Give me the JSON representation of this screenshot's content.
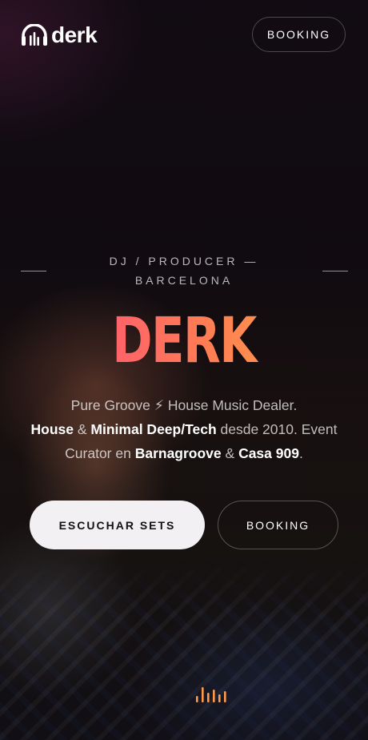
{
  "header": {
    "logo_text": "derk",
    "booking_label": "BOOKING"
  },
  "hero": {
    "tagline": "DJ / PRODUCER — BARCELONA",
    "title": "DERK",
    "description": {
      "part1": "Pure Groove ⚡ House Music Dealer.",
      "strong1": "House",
      "amp1": " & ",
      "strong2": "Minimal Deep/Tech",
      "part2": " desde 2010. Event Curator en ",
      "strong3": "Barnagroove",
      "amp2": " & ",
      "strong4": "Casa 909",
      "end": "."
    },
    "primary_button": "ESCUCHAR SETS",
    "secondary_button": "BOOKING"
  },
  "icons": {
    "logo": "headphones-equalizer-icon",
    "scroll": "equalizer-icon"
  },
  "colors": {
    "title_gradient_start": "#ff4e7a",
    "title_gradient_end": "#ffa646",
    "primary_button_bg": "#f2f0f3",
    "equalizer_color": "#ff9a4a"
  }
}
